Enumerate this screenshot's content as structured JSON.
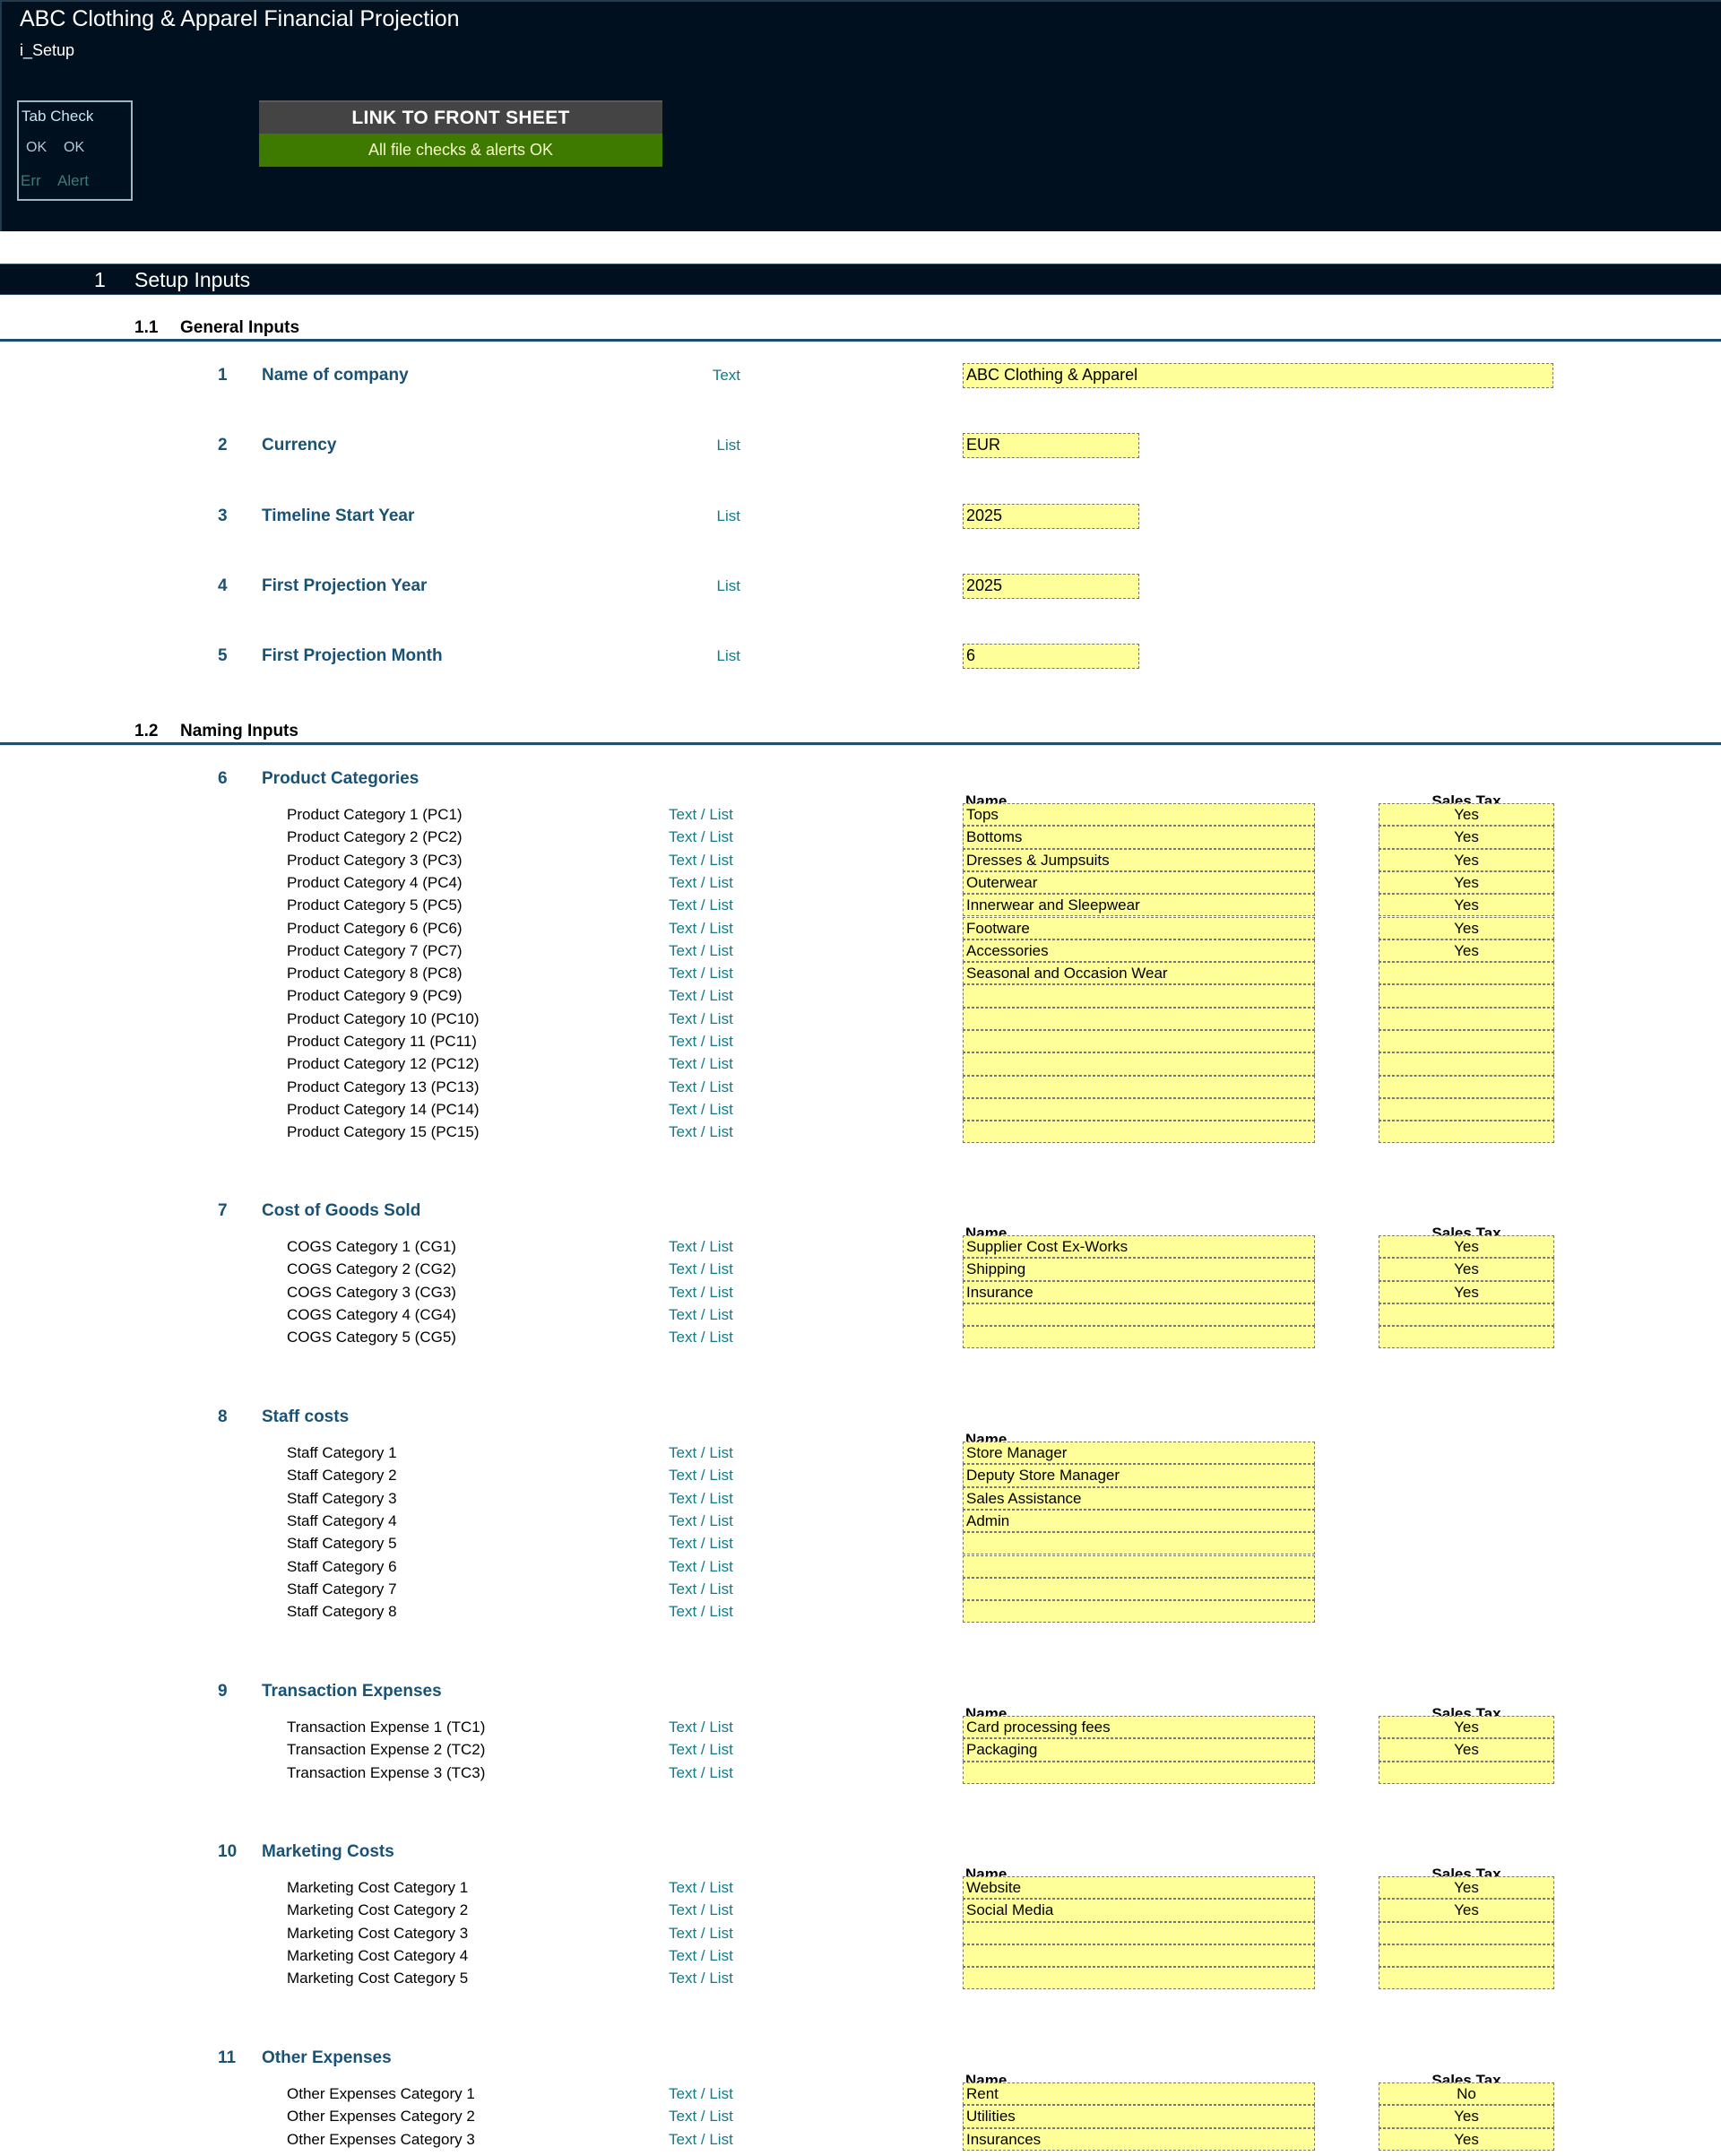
{
  "header": {
    "app_title": "ABC Clothing & Apparel Financial Projection",
    "sheet_name": "i_Setup",
    "tab_check": {
      "title": "Tab Check",
      "ok_error": "OK",
      "ok_alert": "OK",
      "err_label": "Err",
      "alert_label": "Alert"
    },
    "link_button": "LINK TO FRONT SHEET",
    "status_message": "All file checks & alerts OK",
    "colors": {
      "header_bg": "#00101f",
      "status_ok": "#3f7a00",
      "input_fill": "#ffff99",
      "label_blue": "#1a5276",
      "type_teal": "#127a8a"
    }
  },
  "section": {
    "number": "1",
    "title": "Setup Inputs"
  },
  "general": {
    "number": "1.1",
    "title": "General Inputs",
    "rows": [
      {
        "num": "1",
        "label": "Name of company",
        "type": "Text",
        "value": "ABC Clothing & Apparel"
      },
      {
        "num": "2",
        "label": "Currency",
        "type": "List",
        "value": "EUR"
      },
      {
        "num": "3",
        "label": "Timeline Start Year",
        "type": "List",
        "value": "2025"
      },
      {
        "num": "4",
        "label": "First Projection Year",
        "type": "List",
        "value": "2025"
      },
      {
        "num": "5",
        "label": "First Projection Month",
        "type": "List",
        "value": "6"
      }
    ]
  },
  "naming": {
    "number": "1.2",
    "title": "Naming Inputs",
    "col_name": "Name",
    "col_tax": "Sales Tax",
    "groups": [
      {
        "num": "6",
        "title": "Product Categories",
        "has_tax": true,
        "rows": [
          {
            "label": "Product Category 1 (PC1)",
            "type": "Text / List",
            "name": "Tops",
            "tax": "Yes"
          },
          {
            "label": "Product Category 2 (PC2)",
            "type": "Text / List",
            "name": "Bottoms",
            "tax": "Yes"
          },
          {
            "label": "Product Category 3 (PC3)",
            "type": "Text / List",
            "name": "Dresses & Jumpsuits",
            "tax": "Yes"
          },
          {
            "label": "Product Category 4 (PC4)",
            "type": "Text / List",
            "name": "Outerwear",
            "tax": "Yes"
          },
          {
            "label": "Product Category 5 (PC5)",
            "type": "Text / List",
            "name": "Innerwear and Sleepwear",
            "tax": "Yes"
          },
          {
            "label": "Product Category 6 (PC6)",
            "type": "Text / List",
            "name": "Footware",
            "tax": "Yes"
          },
          {
            "label": "Product Category 7 (PC7)",
            "type": "Text / List",
            "name": "Accessories",
            "tax": "Yes"
          },
          {
            "label": "Product Category 8 (PC8)",
            "type": "Text / List",
            "name": "Seasonal and Occasion Wear",
            "tax": ""
          },
          {
            "label": "Product Category 9 (PC9)",
            "type": "Text / List",
            "name": "",
            "tax": ""
          },
          {
            "label": "Product Category 10 (PC10)",
            "type": "Text / List",
            "name": "",
            "tax": ""
          },
          {
            "label": "Product Category 11 (PC11)",
            "type": "Text / List",
            "name": "",
            "tax": ""
          },
          {
            "label": "Product Category 12 (PC12)",
            "type": "Text / List",
            "name": "",
            "tax": ""
          },
          {
            "label": "Product Category 13 (PC13)",
            "type": "Text / List",
            "name": "",
            "tax": ""
          },
          {
            "label": "Product Category 14 (PC14)",
            "type": "Text / List",
            "name": "",
            "tax": ""
          },
          {
            "label": "Product Category 15 (PC15)",
            "type": "Text / List",
            "name": "",
            "tax": ""
          }
        ]
      },
      {
        "num": "7",
        "title": "Cost of Goods Sold",
        "has_tax": true,
        "rows": [
          {
            "label": "COGS Category 1 (CG1)",
            "type": "Text / List",
            "name": "Supplier Cost Ex-Works",
            "tax": "Yes"
          },
          {
            "label": "COGS Category 2 (CG2)",
            "type": "Text / List",
            "name": "Shipping",
            "tax": "Yes"
          },
          {
            "label": "COGS Category 3 (CG3)",
            "type": "Text / List",
            "name": "Insurance",
            "tax": "Yes"
          },
          {
            "label": "COGS Category 4 (CG4)",
            "type": "Text / List",
            "name": "",
            "tax": ""
          },
          {
            "label": "COGS Category 5 (CG5)",
            "type": "Text / List",
            "name": "",
            "tax": ""
          }
        ]
      },
      {
        "num": "8",
        "title": "Staff costs",
        "has_tax": false,
        "rows": [
          {
            "label": "Staff Category 1",
            "type": "Text / List",
            "name": "Store Manager"
          },
          {
            "label": "Staff Category 2",
            "type": "Text / List",
            "name": "Deputy Store Manager"
          },
          {
            "label": "Staff Category 3",
            "type": "Text / List",
            "name": "Sales Assistance"
          },
          {
            "label": "Staff Category 4",
            "type": "Text / List",
            "name": "Admin"
          },
          {
            "label": "Staff Category 5",
            "type": "Text / List",
            "name": ""
          },
          {
            "label": "Staff Category 6",
            "type": "Text / List",
            "name": ""
          },
          {
            "label": "Staff Category 7",
            "type": "Text / List",
            "name": ""
          },
          {
            "label": "Staff Category 8",
            "type": "Text / List",
            "name": ""
          }
        ]
      },
      {
        "num": "9",
        "title": "Transaction Expenses",
        "has_tax": true,
        "rows": [
          {
            "label": "Transaction Expense 1 (TC1)",
            "type": "Text / List",
            "name": "Card processing fees",
            "tax": "Yes"
          },
          {
            "label": "Transaction Expense 2 (TC2)",
            "type": "Text / List",
            "name": "Packaging",
            "tax": "Yes"
          },
          {
            "label": "Transaction Expense 3 (TC3)",
            "type": "Text / List",
            "name": "",
            "tax": ""
          }
        ]
      },
      {
        "num": "10",
        "title": "Marketing Costs",
        "has_tax": true,
        "rows": [
          {
            "label": "Marketing Cost Category 1",
            "type": "Text / List",
            "name": "Website",
            "tax": "Yes"
          },
          {
            "label": "Marketing Cost Category 2",
            "type": "Text / List",
            "name": "Social Media",
            "tax": "Yes"
          },
          {
            "label": "Marketing Cost Category 3",
            "type": "Text / List",
            "name": "",
            "tax": ""
          },
          {
            "label": "Marketing Cost Category 4",
            "type": "Text / List",
            "name": "",
            "tax": ""
          },
          {
            "label": "Marketing Cost Category 5",
            "type": "Text / List",
            "name": "",
            "tax": ""
          }
        ]
      },
      {
        "num": "11",
        "title": "Other Expenses",
        "has_tax": true,
        "rows": [
          {
            "label": "Other Expenses Category 1",
            "type": "Text / List",
            "name": "Rent",
            "tax": "No"
          },
          {
            "label": "Other Expenses Category 2",
            "type": "Text / List",
            "name": "Utilities",
            "tax": "Yes"
          },
          {
            "label": "Other Expenses Category 3",
            "type": "Text / List",
            "name": "Insurances",
            "tax": "Yes"
          }
        ]
      }
    ]
  }
}
